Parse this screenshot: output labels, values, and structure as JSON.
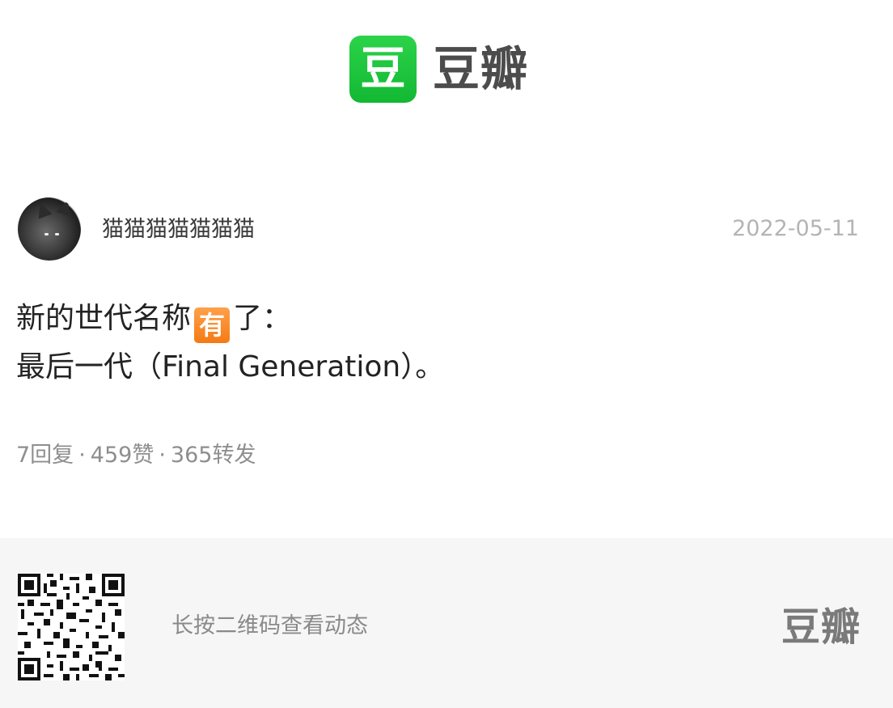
{
  "header": {
    "logo_char": "豆",
    "brand_name": "豆瓣"
  },
  "post": {
    "username": "猫猫猫猫猫猫猫",
    "date": "2022-05-11",
    "content_line1_before": "新的世代名称",
    "content_emoji": "有",
    "content_line1_after": "了：",
    "content_line2": "最后一代（Final Generation）。",
    "stats": {
      "replies": "7回复",
      "likes": "459赞",
      "reposts": "365转发",
      "separator": "·"
    }
  },
  "footer": {
    "qr_hint": "长按二维码查看动态",
    "brand_name": "豆瓣"
  },
  "colors": {
    "logo_green": "#17bd36",
    "emoji_orange": "#f47a14",
    "footer_bg": "#f6f6f6",
    "date_gray": "#b4b4b4"
  }
}
